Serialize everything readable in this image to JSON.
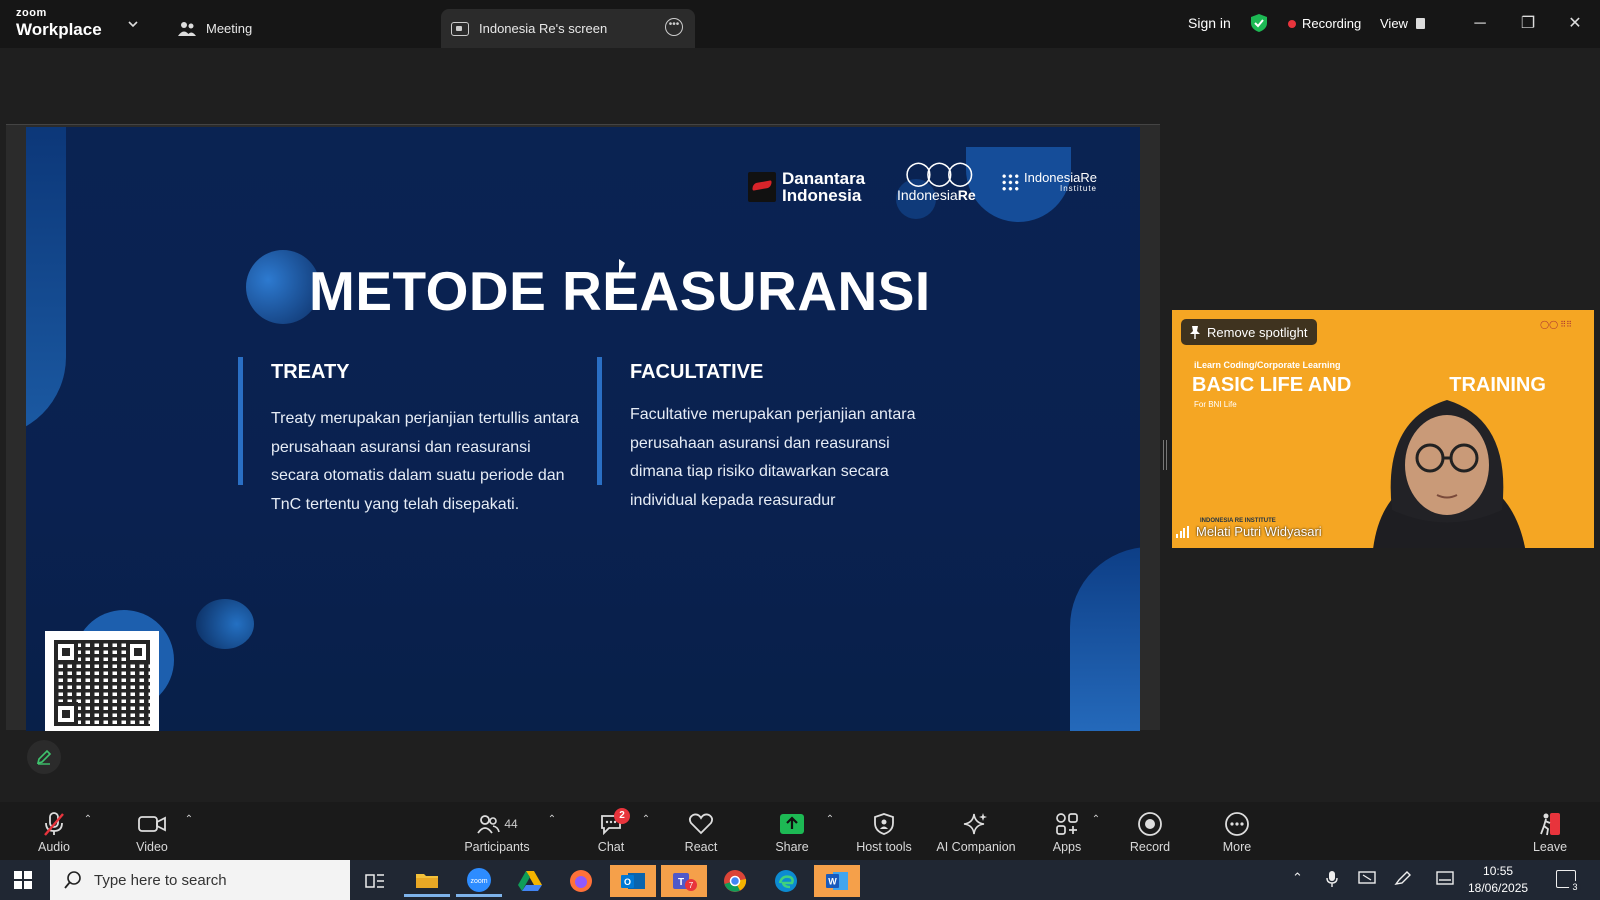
{
  "window": {
    "brand_top": "zoom",
    "brand_bottom": "Workplace",
    "tabs": [
      {
        "label": "Meeting"
      },
      {
        "label": "Indonesia Re's screen"
      }
    ],
    "sign_in": "Sign in",
    "recording": "Recording",
    "view": "View",
    "colors": {
      "recording_dot": "#e8343c",
      "shield": "#1db954",
      "titlebar": "#161616"
    }
  },
  "slide": {
    "title": "METODE REASURANSI",
    "logos": {
      "danantara_line1": "Danantara",
      "danantara_line2": "Indonesia",
      "indonesiare_prefix": "Indonesia",
      "indonesiare_suffix": "Re",
      "institute_line1": "IndonesiaRe",
      "institute_line2": "Institute"
    },
    "columns": [
      {
        "heading": "TREATY",
        "body": "Treaty merupakan perjanjian tertullis antara perusahaan asuransi dan reasuransi secara otomatis dalam suatu periode dan TnC tertentu yang telah disepakati."
      },
      {
        "heading": "FACULTATIVE",
        "body": "Facultative merupakan perjanjian antara perusahaan asuransi dan reasuransi dimana tiap risiko ditawarkan secara individual kepada reasuradur"
      }
    ],
    "colors": {
      "background": "#0a2352",
      "accent": "#2a6fc4"
    }
  },
  "video": {
    "remove_spotlight": "Remove spotlight",
    "participant_name": "Melati Putri Widyasari",
    "background_line1": "iLearn Coding/Corporate Learning",
    "background_line2": "BASIC LIFE AND",
    "background_line3": "TRAINING",
    "background_line4": "For BNI Life",
    "background_footer": "INDONESIA RE INSTITUTE",
    "colors": {
      "background": "#f5a623"
    }
  },
  "toolbar": {
    "audio": "Audio",
    "video": "Video",
    "participants": "Participants",
    "participants_count": "44",
    "chat": "Chat",
    "chat_badge": "2",
    "react": "React",
    "share": "Share",
    "host_tools": "Host tools",
    "ai_companion": "AI Companion",
    "apps": "Apps",
    "record": "Record",
    "more": "More",
    "leave": "Leave",
    "colors": {
      "share_green": "#1db954",
      "mute_red": "#e8343c",
      "leave_red": "#e8343c"
    }
  },
  "taskbar": {
    "search_placeholder": "Type here to search",
    "time": "10:55",
    "date": "18/06/2025",
    "teams_badge": "7",
    "notification_count": "3"
  }
}
